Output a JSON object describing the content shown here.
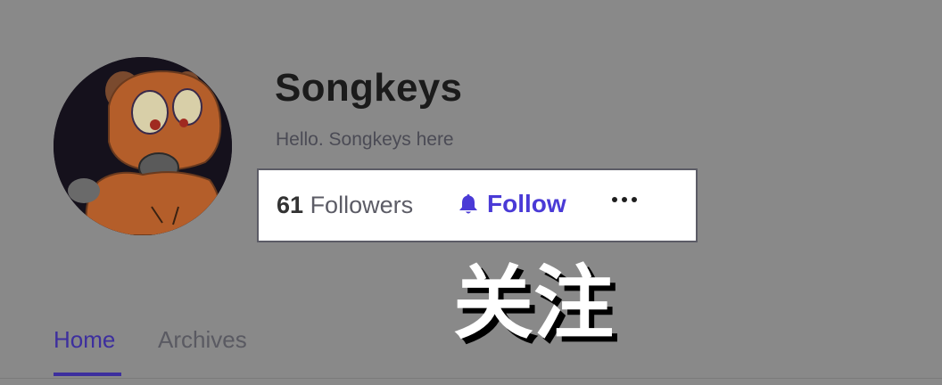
{
  "profile": {
    "name": "Songkeys",
    "bio": "Hello. Songkeys here",
    "avatar_icon": "cartoon-bear-avatar"
  },
  "actions": {
    "followers_count": "61",
    "followers_label": "Followers",
    "follow_label": "Follow",
    "follow_icon": "bell-icon",
    "more_icon": "more-horizontal-icon"
  },
  "overlay": {
    "text": "关注"
  },
  "tabs": [
    {
      "label": "Home",
      "active": true
    },
    {
      "label": "Archives",
      "active": false
    }
  ],
  "colors": {
    "background": "#898989",
    "accent": "#4a3ad6",
    "active_tab": "#3d2f9e"
  }
}
